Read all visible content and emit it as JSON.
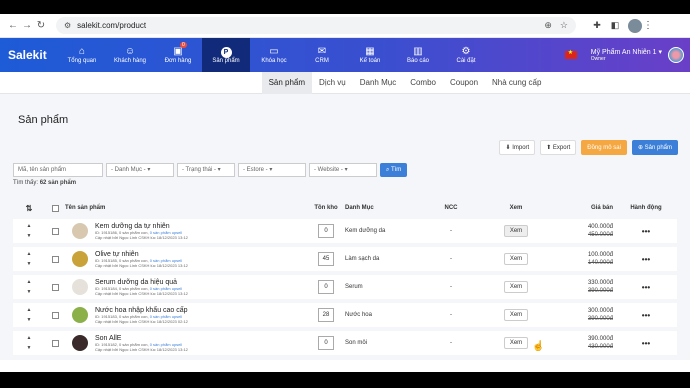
{
  "browser": {
    "url": "salekit.com/product"
  },
  "brand": {
    "logo_text": "Salekit"
  },
  "menu": [
    {
      "label": "Tổng quan",
      "icon": "home-icon",
      "glyph": "⌂"
    },
    {
      "label": "Khách hàng",
      "icon": "users-icon",
      "glyph": "☺"
    },
    {
      "label": "Đơn hàng",
      "icon": "cart-icon",
      "glyph": "▣",
      "badge": "0"
    },
    {
      "label": "Sản phẩm",
      "icon": "product-icon",
      "glyph": "P",
      "active": true
    },
    {
      "label": "Khóa học",
      "icon": "course-icon",
      "glyph": "▭"
    },
    {
      "label": "CRM",
      "icon": "crm-icon",
      "glyph": "✉"
    },
    {
      "label": "Kế toán",
      "icon": "accounting-icon",
      "glyph": "▦"
    },
    {
      "label": "Báo cáo",
      "icon": "report-icon",
      "glyph": "▥"
    },
    {
      "label": "Cài đặt",
      "icon": "settings-icon",
      "glyph": "⚙"
    }
  ],
  "account": {
    "shop": "Mỹ Phẩm An Nhiên 1 ▾",
    "role": "Owner"
  },
  "subtabs": [
    "Sản phẩm",
    "Dịch vụ",
    "Danh Mục",
    "Combo",
    "Coupon",
    "Nhà cung cấp"
  ],
  "page": {
    "title": "Sản phẩm"
  },
  "toolbar": {
    "import": "Import",
    "export": "Export",
    "sync": "Đồng mô sai",
    "add": "Sản phẩm"
  },
  "filters": {
    "search_placeholder": "Mã, tên sản phẩm",
    "category": "- Danh Mục -",
    "status": "- Trạng thái -",
    "estore": "- Estore -",
    "website": "- Website -",
    "search_button": "Tìm"
  },
  "found": {
    "label": "Tìm thấy:",
    "count": "62 sản phẩm"
  },
  "columns": {
    "name": "Tên sản phẩm",
    "stock": "Tồn kho",
    "category": "Danh Mục",
    "ncc": "NCC",
    "view": "Xem",
    "price": "Giá bán",
    "action": "Hành động"
  },
  "rows": [
    {
      "name": "Kem dưỡng da tự nhiên",
      "meta1": "ID: 1915186, 0 sản phẩm con,",
      "link": "0 sản phẩm upsell",
      "meta2": "Cập nhật bởi Ngọc Linh CSKH lúc 18/12/2023 13:12",
      "stock": "0",
      "category": "Kem dưỡng da",
      "ncc": "-",
      "view": "Xem",
      "price": "400.000đ",
      "old_price": "450.000đ",
      "action": "•••",
      "img_color": "#d8c8b0"
    },
    {
      "name": "Olive tự nhiên",
      "meta1": "ID: 1915185, 0 sản phẩm con,",
      "link": "0 sản phẩm upsell",
      "meta2": "Cập nhật bởi Ngọc Linh CSKH lúc 18/12/2023 13:12",
      "stock": "45",
      "category": "Làm sạch da",
      "ncc": "-",
      "view": "Xem",
      "price": "100.000đ",
      "old_price": "140.000đ",
      "action": "•••",
      "img_color": "#c9a23a"
    },
    {
      "name": "Serum dưỡng da hiệu quả",
      "meta1": "ID: 1915184, 0 sản phẩm con,",
      "link": "0 sản phẩm upsell",
      "meta2": "Cập nhật bởi Ngọc Linh CSKH lúc 18/12/2023 13:12",
      "stock": "0",
      "category": "Serum",
      "ncc": "-",
      "view": "Xem",
      "price": "330.000đ",
      "old_price": "390.000đ",
      "action": "•••",
      "img_color": "#e6e1da"
    },
    {
      "name": "Nước hoa nhập khẩu cao cấp",
      "meta1": "ID: 1915183, 0 sản phẩm con,",
      "link": "0 sản phẩm upsell",
      "meta2": "Cập nhật bởi Ngọc Linh CSKH lúc 18/12/2023 02:12",
      "stock": "28",
      "category": "Nước hoa",
      "ncc": "-",
      "view": "Xem",
      "price": "300.000đ",
      "old_price": "390.000đ",
      "action": "•••",
      "img_color": "#8bb04a"
    },
    {
      "name": "Son AllE",
      "meta1": "ID: 1915182, 0 sản phẩm con,",
      "link": "0 sản phẩm upsell",
      "meta2": "Cập nhật bởi Ngọc Linh CSKH lúc 18/12/2023 13:12",
      "stock": "0",
      "category": "Son môi",
      "ncc": "-",
      "view": "Xem",
      "price": "390.000đ",
      "old_price": "430.000đ",
      "action": "•••",
      "img_color": "#3a2a2a"
    }
  ]
}
